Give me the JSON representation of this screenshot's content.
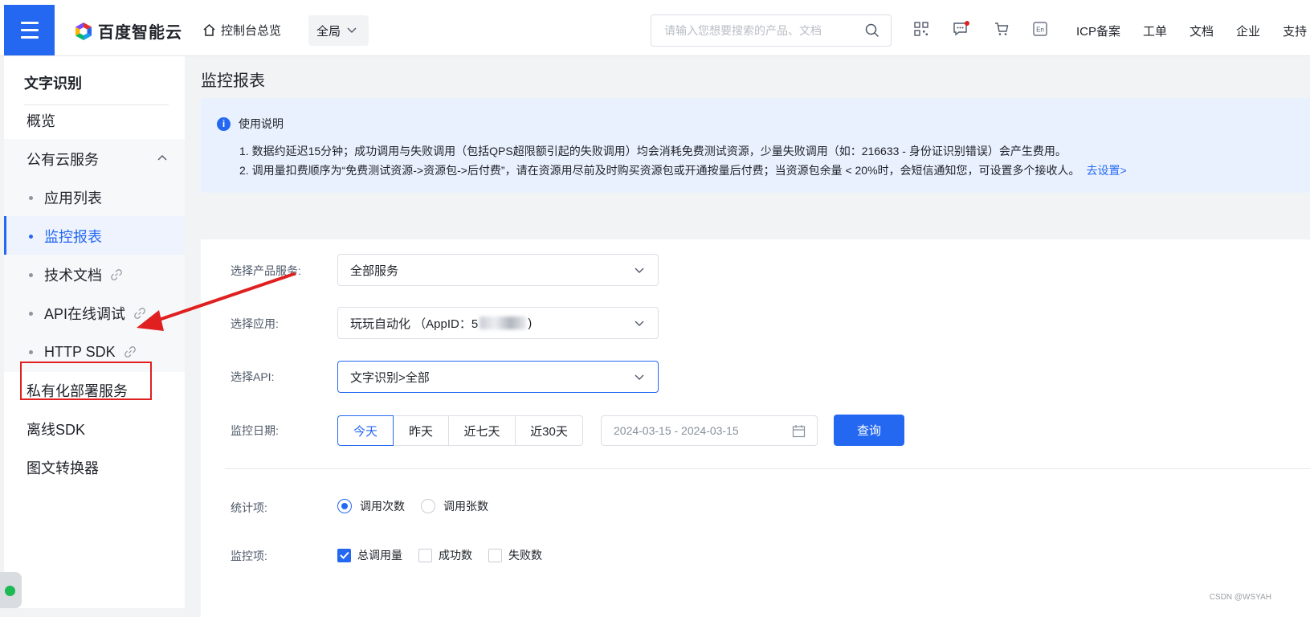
{
  "header": {
    "brand": "百度智能云",
    "console_home": "控制台总览",
    "scope": "全局",
    "search_placeholder": "请输入您想要搜索的产品、文档",
    "links": [
      "ICP备案",
      "工单",
      "文档",
      "企业",
      "支持"
    ]
  },
  "sidebar": {
    "title": "文字识别",
    "items": [
      {
        "label": "概览"
      },
      {
        "label": "公有云服务"
      },
      {
        "label": "应用列表"
      },
      {
        "label": "监控报表"
      },
      {
        "label": "技术文档"
      },
      {
        "label": "API在线调试"
      },
      {
        "label": "HTTP SDK"
      },
      {
        "label": "私有化部署服务"
      },
      {
        "label": "离线SDK"
      },
      {
        "label": "图文转换器"
      }
    ]
  },
  "main": {
    "title": "监控报表",
    "notice": {
      "heading": "使用说明",
      "line1": "1. 数据约延迟15分钟；成功调用与失败调用（包括QPS超限额引起的失败调用）均会消耗免费测试资源，少量失败调用（如：216633 - 身份证识别错误）会产生费用。",
      "line2": "2. 调用量扣费顺序为“免费测试资源->资源包->后付费”，请在资源用尽前及时购买资源包或开通按量后付费；当资源包余量 < 20%时，会短信通知您，可设置多个接收人。",
      "link": "去设置>"
    },
    "form": {
      "product_label": "选择产品服务:",
      "product_value": "全部服务",
      "app_label": "选择应用:",
      "app_value_prefix": "玩玩自动化 （AppID：5",
      "app_value_suffix": ")",
      "api_label": "选择API:",
      "api_value": "文字识别>全部",
      "date_label": "监控日期:",
      "date_options": [
        "今天",
        "昨天",
        "近七天",
        "近30天"
      ],
      "date_range": "2024-03-15 - 2024-03-15",
      "query_button": "查询",
      "stat_label": "统计项:",
      "stat_options": [
        "调用次数",
        "调用张数"
      ],
      "monitor_label": "监控项:",
      "monitor_options": [
        "总调用量",
        "成功数",
        "失败数"
      ]
    }
  },
  "watermark": "CSDN @WSYAH",
  "colors": {
    "accent": "#2468f2",
    "annotation": "#e02020"
  }
}
